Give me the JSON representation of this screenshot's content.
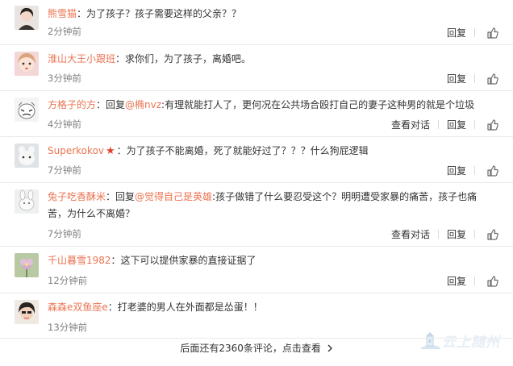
{
  "comments": [
    {
      "user": "熊雪猫",
      "parts": [
        {
          "t": "：为了孩子？孩子需要这样的父亲？？"
        }
      ],
      "time": "2分钟前",
      "reply": "回复",
      "thumb": "like-icon",
      "has_convo": false
    },
    {
      "user": "淮山大王小跟班",
      "parts": [
        {
          "t": "：求你们，为了孩子，离婚吧。"
        }
      ],
      "time": "3分钟前",
      "reply": "回复",
      "thumb": "like-icon",
      "has_convo": false
    },
    {
      "user": "方格子的方",
      "parts": [
        {
          "t": "：回复"
        },
        {
          "t": "@椭nvz",
          "at": true
        },
        {
          "t": ":有理就能打人了，更何况在公共场合殴打自己的妻子这种男的就是个垃圾"
        }
      ],
      "time": "4分钟前",
      "reply": "回复",
      "convo": "查看对话",
      "thumb": "like-icon",
      "has_convo": true
    },
    {
      "user": "Superkokov",
      "badge": "★",
      "parts": [
        {
          "t": "：为了孩子不能离婚，死了就能好过了？？？什么狗屁逻辑"
        }
      ],
      "time": "7分钟前",
      "reply": "回复",
      "thumb": "like-icon",
      "has_convo": false
    },
    {
      "user": "兔子吃香酥米",
      "parts": [
        {
          "t": "：回复"
        },
        {
          "t": "@觉得自己是英雄",
          "at": true
        },
        {
          "t": ":孩子做错了什么要忍受这个？明明遭受家暴的痛苦，孩子也痛苦，为什么不离婚？"
        }
      ],
      "time": "7分钟前",
      "reply": "回复",
      "convo": "查看对话",
      "thumb": "like-icon",
      "has_convo": true
    },
    {
      "user": "千山暮雪1982",
      "parts": [
        {
          "t": "：这下可以提供家暴的直接证据了"
        }
      ],
      "time": "12分钟前",
      "reply": "回复",
      "thumb": "like-icon",
      "has_convo": false
    },
    {
      "user": "森森e双鱼座e",
      "parts": [
        {
          "t": "：打老婆的男人在外面都是怂蛋！！"
        }
      ],
      "time": "13分钟前",
      "reply": "回复",
      "thumb": "like-icon",
      "has_convo": false
    }
  ],
  "more_link": "后面还有2360条评论，点击查看",
  "watermark": "云上随州"
}
